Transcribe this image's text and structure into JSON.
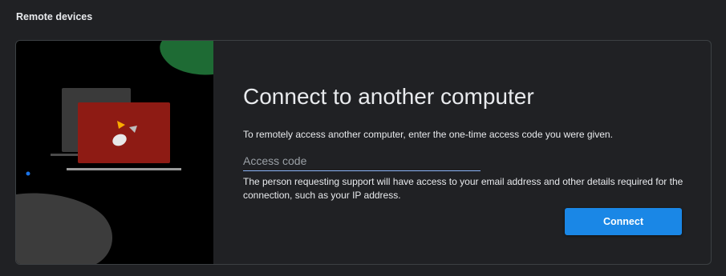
{
  "section": {
    "title": "Remote devices"
  },
  "connect_card": {
    "heading": "Connect to another computer",
    "description": "To remotely access another computer, enter the one-time access code you were given.",
    "access_code": {
      "value": "",
      "placeholder": "Access code"
    },
    "notice": "The person requesting support will have access to your email address and other details required for the connection, such as your IP address.",
    "connect_label": "Connect"
  },
  "illustration": {
    "icon": "remote-desktop-illustration",
    "colors": {
      "background": "#000000",
      "green_blob": "#1e6b34",
      "gray_blob": "#3c3c3c",
      "laptop_back": "#3a3a3a",
      "laptop_front": "#8e1b14",
      "accent_yellow": "#f9ab00",
      "accent_blue": "#1a73e8"
    }
  },
  "colors": {
    "page_background": "#202124",
    "button": "#1a87e6",
    "input_underline": "#8ab4f8"
  }
}
